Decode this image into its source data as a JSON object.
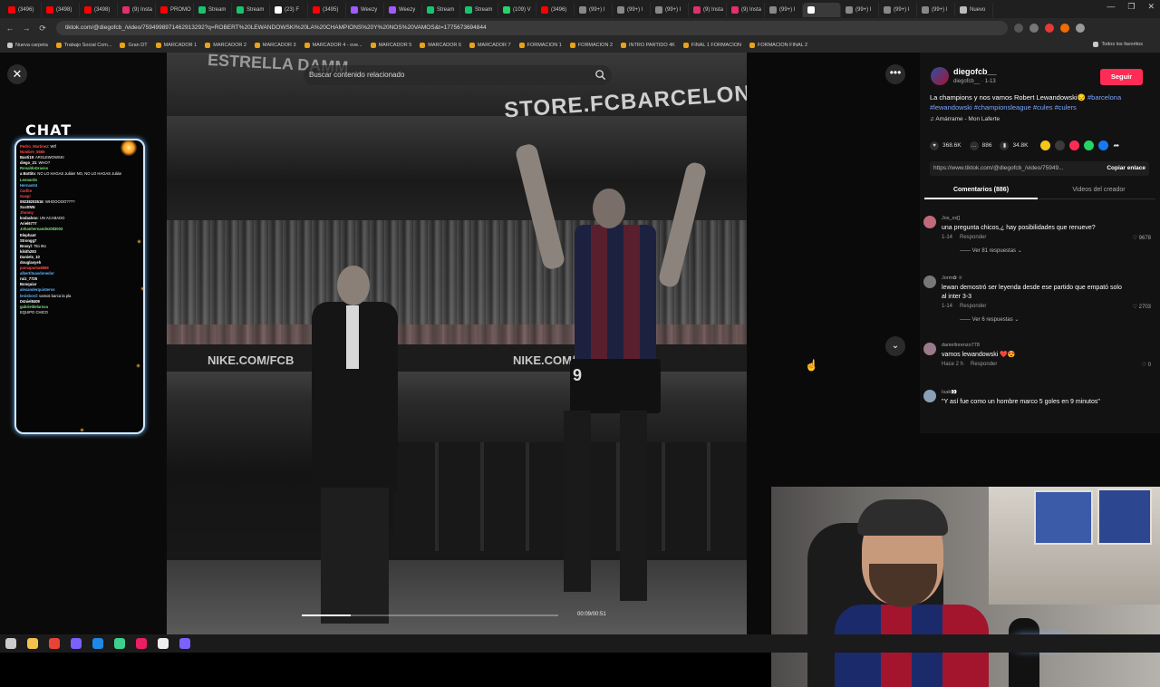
{
  "browser": {
    "tabs": [
      {
        "label": "(3496)",
        "color": "#ff0000"
      },
      {
        "label": "(3498)",
        "color": "#ff0000"
      },
      {
        "label": "(3498)",
        "color": "#ff0000"
      },
      {
        "label": "(9) Insta",
        "color": "#e1306c"
      },
      {
        "label": "PROMO",
        "color": "#ff0000"
      },
      {
        "label": "Stream",
        "color": "#18c46b"
      },
      {
        "label": "Stream",
        "color": "#18c46b"
      },
      {
        "label": "(23) F",
        "color": "#ffffff"
      },
      {
        "label": "(3495)",
        "color": "#ff0000"
      },
      {
        "label": "Weezy",
        "color": "#a259ff"
      },
      {
        "label": "Weezy",
        "color": "#a259ff"
      },
      {
        "label": "Stream",
        "color": "#18c46b"
      },
      {
        "label": "Stream",
        "color": "#18c46b"
      },
      {
        "label": "(109) V",
        "color": "#25d366"
      },
      {
        "label": "(3496)",
        "color": "#ff0000"
      },
      {
        "label": "(99+) I",
        "color": "#888888"
      },
      {
        "label": "(99+) I",
        "color": "#888888"
      },
      {
        "label": "(99+) I",
        "color": "#888888"
      },
      {
        "label": "(9) Insta",
        "color": "#e1306c"
      },
      {
        "label": "(9) Insta",
        "color": "#e1306c"
      },
      {
        "label": "(99+) I",
        "color": "#888888"
      },
      {
        "label": "",
        "color": "#ffffff",
        "active": true
      },
      {
        "label": "(99+) I",
        "color": "#888888"
      },
      {
        "label": "(99+) I",
        "color": "#888888"
      },
      {
        "label": "(99+) I",
        "color": "#888888"
      },
      {
        "label": "Nuevo",
        "color": "#bbbbbb"
      }
    ],
    "url": "tiktok.com/@diegofcb_/video/7594998971462913292?q=ROBERT%20LEWANDOWSKI%20LA%20CHAMPIONS%20Y%20NOS%20VAMOS&t=1775673694844"
  },
  "bookmarks": {
    "items": [
      {
        "label": "Nueva carpeta",
        "folder": true
      },
      {
        "label": "Trabajo Social Com...",
        "folder": false
      },
      {
        "label": "Gran DT",
        "folder": false
      },
      {
        "label": "MARCADOR 1",
        "folder": false
      },
      {
        "label": "MARCADOR 2",
        "folder": false
      },
      {
        "label": "MARCADOR 3",
        "folder": false
      },
      {
        "label": "MARCADOR 4 - ove...",
        "folder": false
      },
      {
        "label": "MARCADOR 5",
        "folder": false
      },
      {
        "label": "MARCADOR 6",
        "folder": false
      },
      {
        "label": "MARCADOR 7",
        "folder": false
      },
      {
        "label": "FORMACION 1",
        "folder": false
      },
      {
        "label": "FORMACION 2",
        "folder": false
      },
      {
        "label": "INTRO PARTIDO 4K",
        "folder": false
      },
      {
        "label": "FINAL 1 FORMACION",
        "folder": false
      },
      {
        "label": "FORMACION FINAL 2",
        "folder": false
      }
    ],
    "all": "Todos los favoritos"
  },
  "chat": {
    "title": "CHAT",
    "lines": [
      {
        "user": "Pedro_Martinez",
        "msg": ": Wtf",
        "color": "#ff4a4a"
      },
      {
        "user": "Nombre_5555",
        "msg": "",
        "color": "#ff4a4a"
      },
      {
        "user": "Basti19",
        "msg": ": ARSLEWOWSKI",
        "color": "#ffffff"
      },
      {
        "user": "diego_21",
        "msg": ": WHO?",
        "color": "#ffffff"
      },
      {
        "user": "RonaldoGrasso",
        "msg": "",
        "color": "#7ee07e"
      },
      {
        "user": "a Bottito",
        "msg": ": NO LO HAGAS Julián! NO, NO LO HAGAS Julián",
        "color": "#ffffff"
      },
      {
        "user": "",
        "msg": "",
        "color": "#ffffff"
      },
      {
        "user": "Leonardo",
        "msg": "",
        "color": "#7ee07e"
      },
      {
        "user": "Hernan04",
        "msg": "",
        "color": "#5fb6ff"
      },
      {
        "user": "Carlito",
        "msg": "",
        "color": "#ff4a4a"
      },
      {
        "user": "Gaspi",
        "msg": "",
        "color": "#ff4a4a"
      },
      {
        "user": "09238203516",
        "msg": ": WHOOOOO????",
        "color": "#ffffff"
      },
      {
        "user": "ScottNN",
        "msg": "",
        "color": "#ffffff"
      },
      {
        "user": "Jhonny",
        "msg": "",
        "color": "#ff4a4a"
      },
      {
        "user": "kodackno",
        "msg": ": UN ACABADO",
        "color": "#ffffff"
      },
      {
        "user": "Ariel6777",
        "msg": "",
        "color": "#ffffff"
      },
      {
        "user": "Johanhernandez083003",
        "msg": "",
        "color": "#7ee07e"
      },
      {
        "user": "Elephant",
        "msg": "",
        "color": "#ffffff"
      },
      {
        "user": "Strongg7",
        "msg": "",
        "color": "#ffffff"
      },
      {
        "user": "Brasyl",
        "msg": ": Tito 9to",
        "color": "#ffffff"
      },
      {
        "user": "kikith283",
        "msg": "",
        "color": "#ffffff"
      },
      {
        "user": "Daniels_10",
        "msg": "",
        "color": "#ffffff"
      },
      {
        "user": "douglasyeh",
        "msg": "",
        "color": "#ffffff"
      },
      {
        "user": "pumapuma8888",
        "msg": "",
        "color": "#ff4a4a"
      },
      {
        "user": "albertitoasdonedor",
        "msg": "",
        "color": "#5fb6ff"
      },
      {
        "user": "ruiz_7725",
        "msg": "",
        "color": "#ffffff"
      },
      {
        "user": "Bonquiar",
        "msg": "",
        "color": "#ffffff"
      },
      {
        "user": "alexanderquinteros",
        "msg": "",
        "color": "#5fb6ff"
      },
      {
        "user": "lenisbord",
        "msg": ": vamos barca la pla",
        "color": "#5fb6ff"
      },
      {
        "user": "D4niel8409",
        "msg": "",
        "color": "#ffffff"
      },
      {
        "user": "gabrieldelarosa",
        "msg": "",
        "color": "#7ee07e"
      },
      {
        "user": "",
        "msg": "EQUIPO CHICO",
        "color": "#ff4a4a"
      }
    ]
  },
  "video": {
    "search_placeholder": "Buscar contenido relacionado",
    "time": "00:09/00:51",
    "progress": 0.19,
    "scene": {
      "estrella": "ESTRELLA DAMM",
      "store": "STORE.FCBARCELONA.COM",
      "board1": "NIKE.COM/FCB",
      "board2": "NIKE.COM/FCB",
      "number": "9"
    }
  },
  "post": {
    "username": "diegofcb__",
    "handle_date": "diegofcb__ · 1-13",
    "follow_label": "Seguir",
    "caption_text": "La champions y nos vamos Robert Lewandowski😔",
    "hashtags": "#barcelona #lewandowski #championsleague #cules #culers",
    "music": "♫  Amárrame - Mon Laferte",
    "likes": "368.6K",
    "comments": "886",
    "saves": "34.8K",
    "link": "https://www.tiktok.com/@diegofcb_/video/75949...",
    "copy_label": "Copiar enlace",
    "tab_comments": "Comentarios (886)",
    "tab_videos": "Videos del creador"
  },
  "comments": [
    {
      "user": "Jos_xx[]",
      "text": "una pregunta chicos,¿ hay posibilidades que renueve?",
      "date": "1-14",
      "reply": "Responder",
      "likes": "9678",
      "replies": "Ver 81 respuestas ⌄",
      "color": "#c06a7a"
    },
    {
      "user": "Jorm✿ ♕",
      "text": "lewan demostró ser leyenda desde ese partido que empató solo al inter 3-3",
      "date": "1-14",
      "reply": "Responder",
      "likes": "2703",
      "replies": "Ver 6 respuestas ⌄",
      "color": "#777777"
    },
    {
      "user": "daniellorenzo778",
      "text": "vamos lewandowski ❤️😍",
      "date": "Hace 2 h",
      "reply": "Responder",
      "likes": "0",
      "replies": "",
      "color": "#9a7a8a"
    },
    {
      "user": "Isak👀",
      "text": "\"Y así fue como un hombre marco 5 goles en 9 minutos\"",
      "date": "",
      "reply": "",
      "likes": "",
      "replies": "",
      "color": "#8aa0b8"
    }
  ],
  "taskbar": {
    "icons": [
      "#cccccc",
      "#f2c14e",
      "#ea4335",
      "#7b61ff",
      "#1e88e5",
      "#3ecf8e",
      "#e91e63",
      "#eeeeee",
      "#7b61ff"
    ]
  }
}
